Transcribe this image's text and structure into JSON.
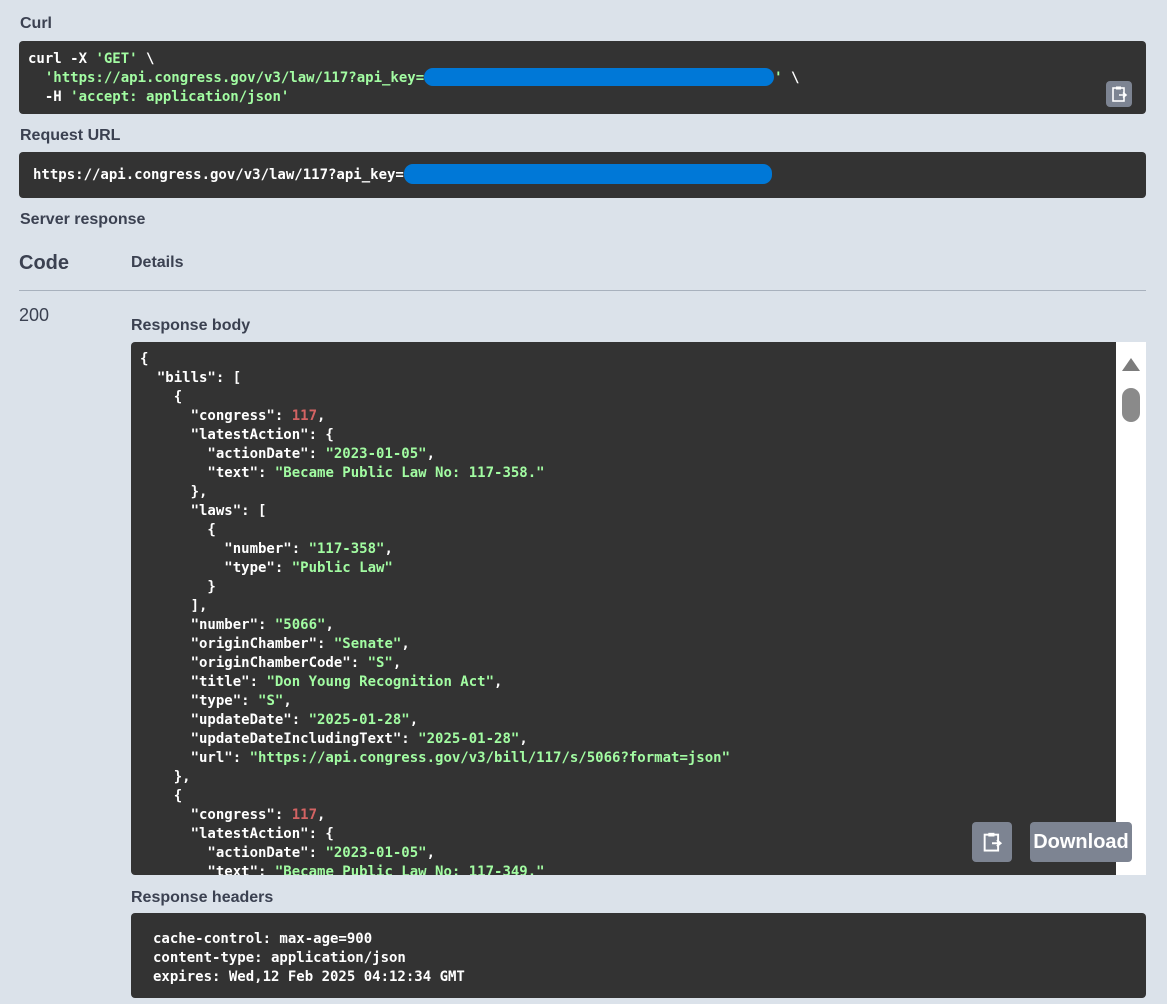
{
  "sections": {
    "curl_label": "Curl",
    "request_url_label": "Request URL",
    "server_response_label": "Server response",
    "code_header": "Code",
    "details_header": "Details",
    "status_code": "200",
    "response_body_label": "Response body",
    "response_headers_label": "Response headers"
  },
  "curl": {
    "line1": "curl -X ",
    "method": "'GET'",
    "line1_end": " \\",
    "url_start": "'https://api.congress.gov/v3/law/117?api_key=",
    "url_end": "'",
    "line2_end": " \\",
    "header_flag": "-H ",
    "header_value": "'accept: application/json'"
  },
  "request_url": {
    "prefix": "https://api.congress.gov/v3/law/117?api_key="
  },
  "response_body": {
    "l01": "{",
    "l02_k": "  \"bills\"",
    "l02_p": ": [",
    "l03": "    {",
    "l04_k": "      \"congress\"",
    "l04_v": "117",
    "l04_e": ",",
    "l05_k": "      \"latestAction\"",
    "l05_p": ": {",
    "l06_k": "        \"actionDate\"",
    "l06_v": "\"2023-01-05\"",
    "l06_e": ",",
    "l07_k": "        \"text\"",
    "l07_v": "\"Became Public Law No: 117-358.\"",
    "l08": "      },",
    "l09_k": "      \"laws\"",
    "l09_p": ": [",
    "l10": "        {",
    "l11_k": "          \"number\"",
    "l11_v": "\"117-358\"",
    "l11_e": ",",
    "l12_k": "          \"type\"",
    "l12_v": "\"Public Law\"",
    "l13": "        }",
    "l14": "      ],",
    "l15_k": "      \"number\"",
    "l15_v": "\"5066\"",
    "l15_e": ",",
    "l16_k": "      \"originChamber\"",
    "l16_v": "\"Senate\"",
    "l16_e": ",",
    "l17_k": "      \"originChamberCode\"",
    "l17_v": "\"S\"",
    "l17_e": ",",
    "l18_k": "      \"title\"",
    "l18_v": "\"Don Young Recognition Act\"",
    "l18_e": ",",
    "l19_k": "      \"type\"",
    "l19_v": "\"S\"",
    "l19_e": ",",
    "l20_k": "      \"updateDate\"",
    "l20_v": "\"2025-01-28\"",
    "l20_e": ",",
    "l21_k": "      \"updateDateIncludingText\"",
    "l21_v": "\"2025-01-28\"",
    "l21_e": ",",
    "l22_k": "      \"url\"",
    "l22_v": "\"https://api.congress.gov/v3/bill/117/s/5066?format=json\"",
    "l23": "    },",
    "l24": "    {",
    "l25_k": "      \"congress\"",
    "l25_v": "117",
    "l25_e": ",",
    "l26_k": "      \"latestAction\"",
    "l26_p": ": {",
    "l27_k": "        \"actionDate\"",
    "l27_v": "\"2023-01-05\"",
    "l27_e": ",",
    "l28_k": "        \"text\"",
    "l28_v": "\"Became Public Law No: 117-349.\""
  },
  "response_headers": {
    "h1": "cache-control: max-age=900",
    "h2": "content-type: application/json",
    "h3": "expires: Wed,12 Feb 2025 04:12:34 GMT"
  },
  "buttons": {
    "download_label": "Download"
  },
  "icons": {
    "copy": "clipboard-copy-icon"
  },
  "colors": {
    "background": "#dbe2ea",
    "code_bg": "#333333",
    "string": "#a2fca2",
    "number": "#d36363",
    "redaction": "#0078d7",
    "button": "#7d8492"
  }
}
